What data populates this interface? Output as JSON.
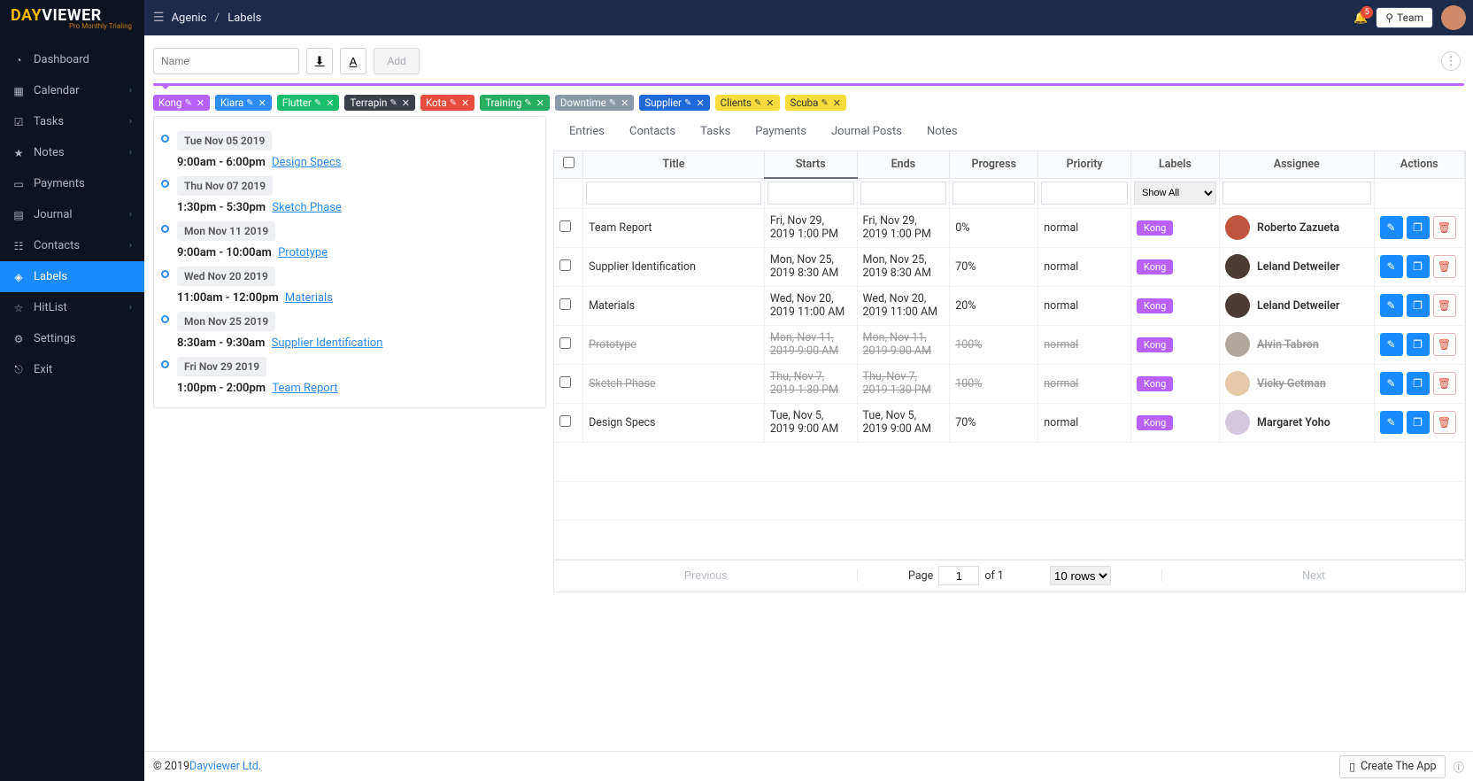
{
  "brand": {
    "day": "DAY",
    "viewer": "VIEWER",
    "sub": "Pro Monthly Trialing"
  },
  "breadcrumb": {
    "root": "Agenic",
    "page": "Labels"
  },
  "notif_count": "5",
  "team_label": "Team",
  "sidebar": [
    {
      "icon": "◔",
      "label": "Dashboard",
      "chev": false
    },
    {
      "icon": "▦",
      "label": "Calendar",
      "chev": true
    },
    {
      "icon": "☑",
      "label": "Tasks",
      "chev": true
    },
    {
      "icon": "★",
      "label": "Notes",
      "chev": true
    },
    {
      "icon": "▭",
      "label": "Payments",
      "chev": false
    },
    {
      "icon": "▤",
      "label": "Journal",
      "chev": true
    },
    {
      "icon": "☷",
      "label": "Contacts",
      "chev": true
    },
    {
      "icon": "◈",
      "label": "Labels",
      "chev": false,
      "active": true
    },
    {
      "icon": "☆",
      "label": "HitList",
      "chev": true
    },
    {
      "icon": "⚙",
      "label": "Settings",
      "chev": false
    },
    {
      "icon": "⎋",
      "label": "Exit",
      "chev": false
    }
  ],
  "toolbar": {
    "name_placeholder": "Name",
    "add_label": "Add"
  },
  "labels": [
    {
      "name": "Kong",
      "bg": "#b861ff"
    },
    {
      "name": "Kiara",
      "bg": "#2d8cf0"
    },
    {
      "name": "Flutter",
      "bg": "#19be6b"
    },
    {
      "name": "Terrapin",
      "bg": "#3b3f4a"
    },
    {
      "name": "Kota",
      "bg": "#e74c3c"
    },
    {
      "name": "Training",
      "bg": "#27ae60"
    },
    {
      "name": "Downtime",
      "bg": "#8c97a7"
    },
    {
      "name": "Supplier",
      "bg": "#1e68d8"
    },
    {
      "name": "Clients",
      "bg": "#f7dc3b",
      "fg": "#333"
    },
    {
      "name": "Scuba",
      "bg": "#f7dc3b",
      "fg": "#333"
    }
  ],
  "events": [
    {
      "date": "Tue Nov 05 2019",
      "time": "9:00am - 6:00pm",
      "title": "Design Specs"
    },
    {
      "date": "Thu Nov 07 2019",
      "time": "1:30pm - 5:30pm",
      "title": "Sketch Phase"
    },
    {
      "date": "Mon Nov 11 2019",
      "time": "9:00am - 10:00am",
      "title": "Prototype"
    },
    {
      "date": "Wed Nov 20 2019",
      "time": "11:00am - 12:00pm",
      "title": "Materials"
    },
    {
      "date": "Mon Nov 25 2019",
      "time": "8:30am - 9:30am",
      "title": "Supplier Identification"
    },
    {
      "date": "Fri Nov 29 2019",
      "time": "1:00pm - 2:00pm",
      "title": "Team Report"
    }
  ],
  "tabs": [
    "Entries",
    "Contacts",
    "Tasks",
    "Payments",
    "Journal Posts",
    "Notes"
  ],
  "columns": {
    "title": "Title",
    "starts": "Starts",
    "ends": "Ends",
    "progress": "Progress",
    "priority": "Priority",
    "labels": "Labels",
    "assignee": "Assignee",
    "actions": "Actions"
  },
  "filter_labels": "Show All",
  "rows": [
    {
      "title": "Team Report",
      "starts": "Fri, Nov 29, 2019 1:00 PM",
      "ends": "Fri, Nov 29, 2019 1:00 PM",
      "progress": "0%",
      "priority": "normal",
      "label": "Kong",
      "assignee": "Roberto Zazueta",
      "done": false,
      "av": "#c0563e"
    },
    {
      "title": "Supplier Identification",
      "starts": "Mon, Nov 25, 2019 8:30 AM",
      "ends": "Mon, Nov 25, 2019 8:30 AM",
      "progress": "70%",
      "priority": "normal",
      "label": "Kong",
      "assignee": "Leland Detweiler",
      "done": false,
      "av": "#4a3b34"
    },
    {
      "title": "Materials",
      "starts": "Wed, Nov 20, 2019 11:00 AM",
      "ends": "Wed, Nov 20, 2019 11:00 AM",
      "progress": "20%",
      "priority": "normal",
      "label": "Kong",
      "assignee": "Leland Detweiler",
      "done": false,
      "av": "#4a3b34"
    },
    {
      "title": "Prototype",
      "starts": "Mon, Nov 11, 2019 9:00 AM",
      "ends": "Mon, Nov 11, 2019 9:00 AM",
      "progress": "100%",
      "priority": "normal",
      "label": "Kong",
      "assignee": "Alvin Tabron",
      "done": true,
      "av": "#b0a79f"
    },
    {
      "title": "Sketch Phase",
      "starts": "Thu, Nov 7, 2019 1:30 PM",
      "ends": "Thu, Nov 7, 2019 1:30 PM",
      "progress": "100%",
      "priority": "normal",
      "label": "Kong",
      "assignee": "Vicky Getman",
      "done": true,
      "av": "#e6c9a8"
    },
    {
      "title": "Design Specs",
      "starts": "Tue, Nov 5, 2019 9:00 AM",
      "ends": "Tue, Nov 5, 2019 9:00 AM",
      "progress": "70%",
      "priority": "normal",
      "label": "Kong",
      "assignee": "Margaret Yoho",
      "done": false,
      "av": "#d4c8dc"
    }
  ],
  "pager": {
    "prev": "Previous",
    "next": "Next",
    "page_label": "Page",
    "page": "1",
    "of": "of 1",
    "rows": "10 rows"
  },
  "footer": {
    "copy": "© 2019 ",
    "link": "Dayviewer Ltd.",
    "create": "Create The App"
  }
}
